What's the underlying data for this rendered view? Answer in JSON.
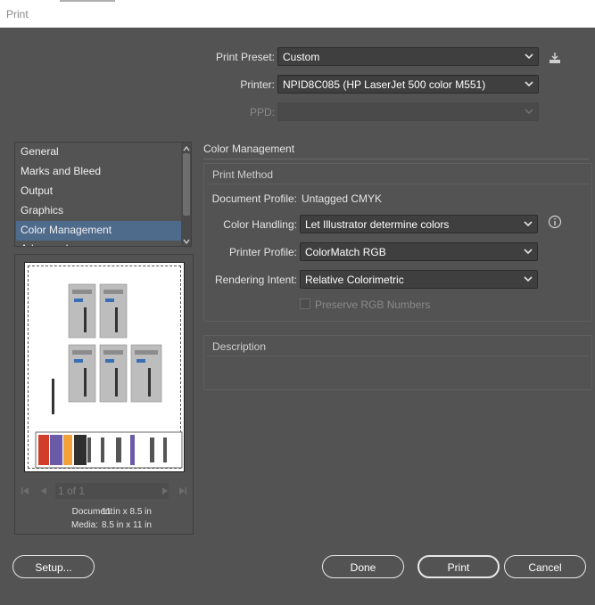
{
  "window": {
    "title": "Print"
  },
  "print_preset": {
    "label": "Print Preset:",
    "value": "Custom"
  },
  "printer": {
    "label": "Printer:",
    "value": "NPID8C085 (HP LaserJet 500 color M551)"
  },
  "ppd": {
    "label": "PPD:",
    "value": ""
  },
  "sidebar": {
    "items": [
      {
        "label": "General"
      },
      {
        "label": "Marks and Bleed"
      },
      {
        "label": "Output"
      },
      {
        "label": "Graphics"
      },
      {
        "label": "Color Management",
        "selected": true
      },
      {
        "label": "Advanced"
      }
    ]
  },
  "preview": {
    "page_indicator": "1 of 1",
    "document_label": "Document:",
    "document_value": "11 in x 8.5 in",
    "media_label": "Media:",
    "media_value": "8.5 in x 11 in"
  },
  "color_management": {
    "title": "Color Management",
    "print_method": {
      "title": "Print Method",
      "document_profile_label": "Document Profile:",
      "document_profile_value": "Untagged CMYK",
      "color_handling_label": "Color Handling:",
      "color_handling_value": "Let Illustrator determine colors",
      "printer_profile_label": "Printer Profile:",
      "printer_profile_value": "ColorMatch RGB",
      "rendering_intent_label": "Rendering Intent:",
      "rendering_intent_value": "Relative Colorimetric",
      "preserve_rgb_label": "Preserve RGB Numbers",
      "preserve_rgb_checked": false
    },
    "description": {
      "title": "Description"
    }
  },
  "buttons": {
    "setup": "Setup...",
    "done": "Done",
    "print": "Print",
    "cancel": "Cancel"
  },
  "colors": {
    "background": "#535353",
    "selection": "#4f6b8c",
    "field": "#3f3f3f"
  }
}
